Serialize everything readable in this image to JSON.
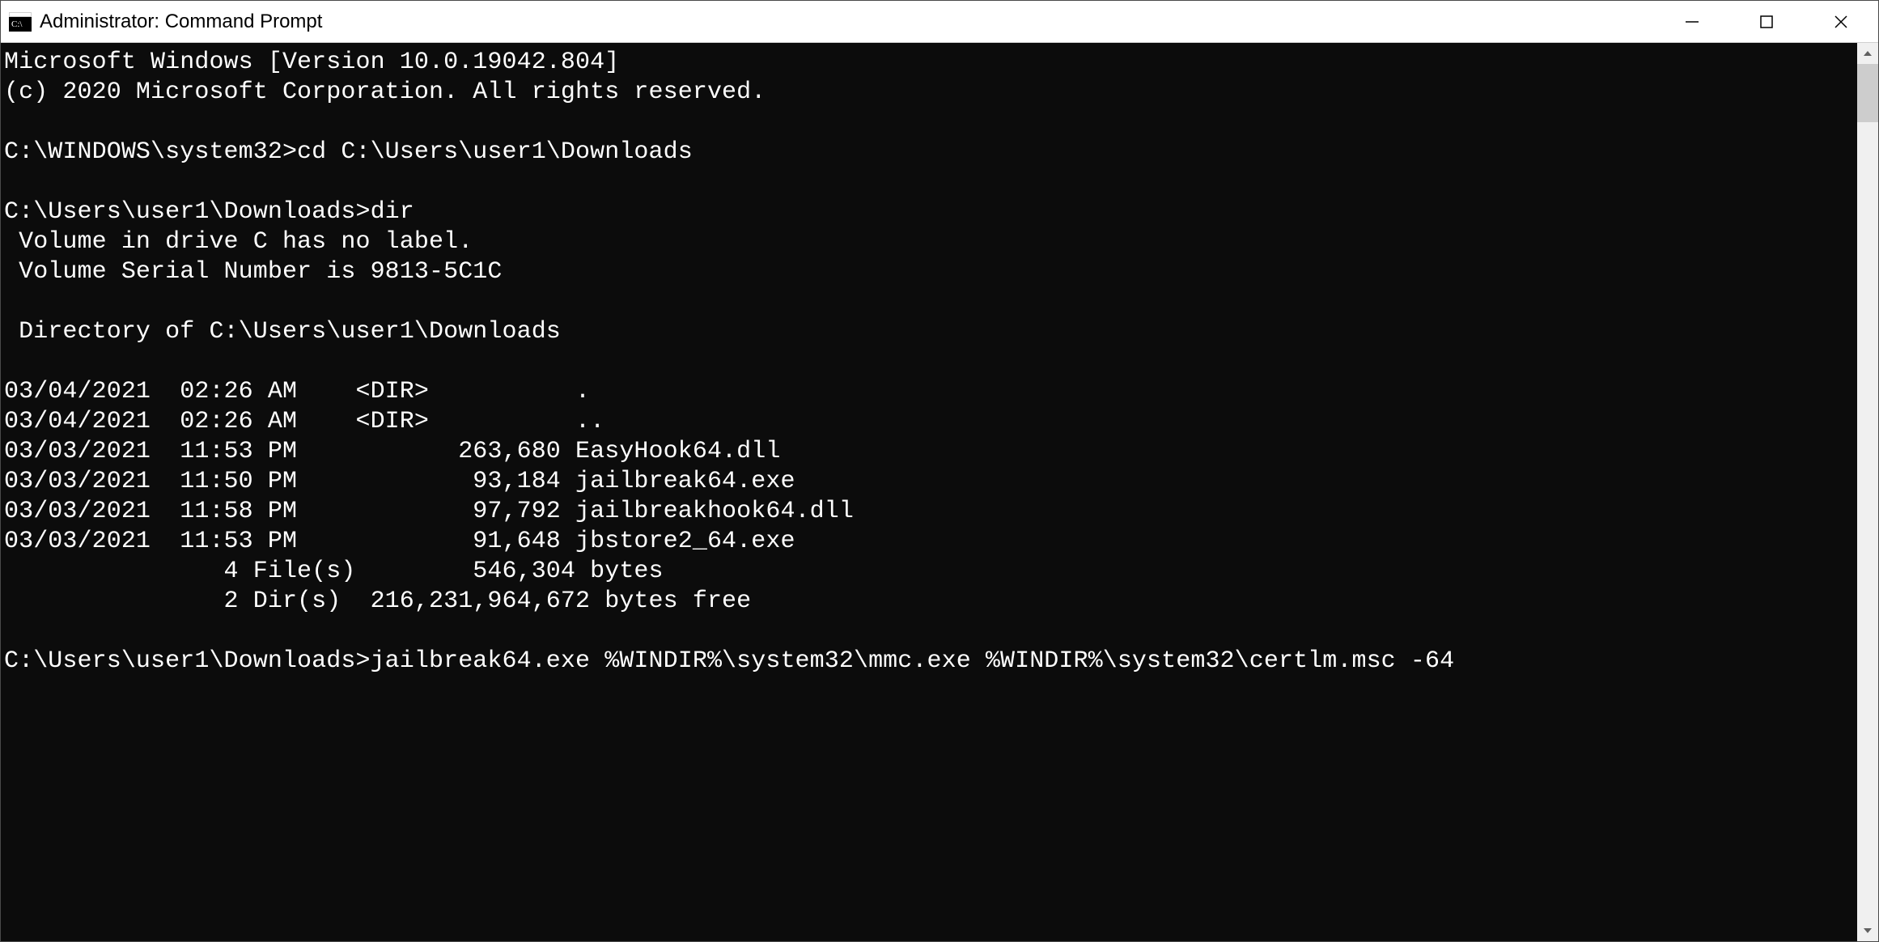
{
  "window": {
    "title": "Administrator: Command Prompt"
  },
  "terminal": {
    "lines": [
      "Microsoft Windows [Version 10.0.19042.804]",
      "(c) 2020 Microsoft Corporation. All rights reserved.",
      "",
      "C:\\WINDOWS\\system32>cd C:\\Users\\user1\\Downloads",
      "",
      "C:\\Users\\user1\\Downloads>dir",
      " Volume in drive C has no label.",
      " Volume Serial Number is 9813-5C1C",
      "",
      " Directory of C:\\Users\\user1\\Downloads",
      "",
      "03/04/2021  02:26 AM    <DIR>          .",
      "03/04/2021  02:26 AM    <DIR>          ..",
      "03/03/2021  11:53 PM           263,680 EasyHook64.dll",
      "03/03/2021  11:50 PM            93,184 jailbreak64.exe",
      "03/03/2021  11:58 PM            97,792 jailbreakhook64.dll",
      "03/03/2021  11:53 PM            91,648 jbstore2_64.exe",
      "               4 File(s)        546,304 bytes",
      "               2 Dir(s)  216,231,964,672 bytes free",
      "",
      "C:\\Users\\user1\\Downloads>jailbreak64.exe %WINDIR%\\system32\\mmc.exe %WINDIR%\\system32\\certlm.msc -64"
    ]
  }
}
